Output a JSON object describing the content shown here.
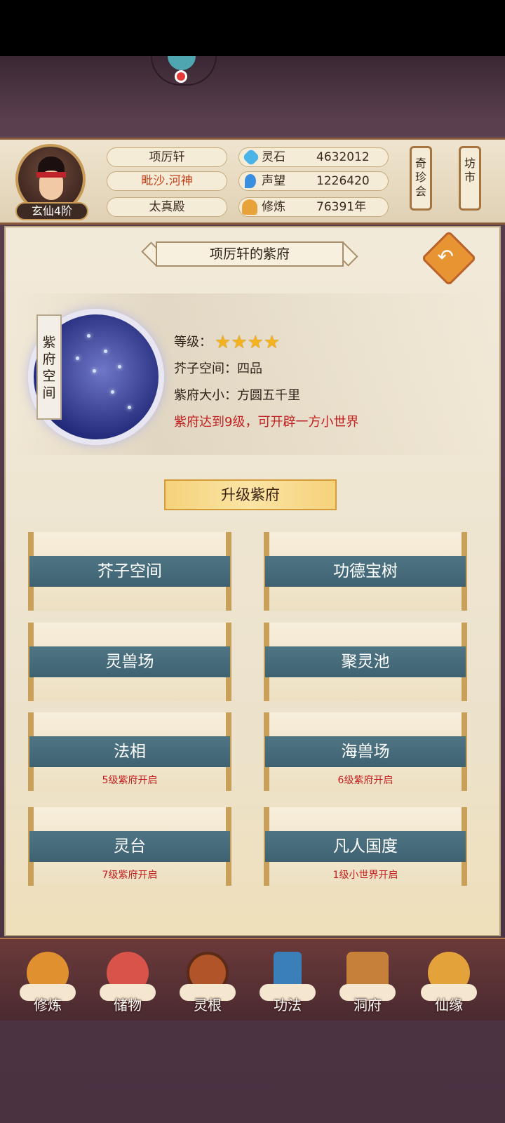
{
  "player": {
    "rank": "玄仙4阶",
    "name": "项厉轩",
    "title": "毗沙.河神",
    "sect": "太真殿"
  },
  "resources": [
    {
      "label": "灵石",
      "value": "4632012",
      "icon": "spirit-stone-icon",
      "color": "#4bb4e6"
    },
    {
      "label": "声望",
      "value": "1226420",
      "icon": "prestige-flame-icon",
      "color": "#3a8ee0"
    },
    {
      "label": "修炼",
      "value": "76391年",
      "icon": "meditation-icon",
      "color": "#e8a23a"
    }
  ],
  "side_buttons": {
    "treasure_fair": "奇珍会",
    "market": "坊市"
  },
  "page": {
    "title": "项厉轩的紫府",
    "back_icon": "return-arrow-icon"
  },
  "info": {
    "orb_label": "紫府空间",
    "level_label": "等级：",
    "stars": 4,
    "space_line": "芥子空间：四品",
    "size_line": "紫府大小：方圆五千里",
    "hint_line": "紫府达到9级，可开辟一方小世界"
  },
  "upgrade_label": "升级紫府",
  "features": [
    {
      "name": "芥子空间",
      "req": ""
    },
    {
      "name": "功德宝树",
      "req": ""
    },
    {
      "name": "灵兽场",
      "req": ""
    },
    {
      "name": "聚灵池",
      "req": ""
    },
    {
      "name": "法相",
      "req": "5级紫府开启"
    },
    {
      "name": "海兽场",
      "req": "6级紫府开启"
    },
    {
      "name": "灵台",
      "req": "7级紫府开启"
    },
    {
      "name": "凡人国度",
      "req": "1级小世界开启"
    }
  ],
  "nav": [
    {
      "label": "修炼",
      "icon": "cultivate-icon",
      "color": "#e0902e"
    },
    {
      "label": "储物",
      "icon": "storage-bag-icon",
      "color": "#d8544a"
    },
    {
      "label": "灵根",
      "icon": "spirit-root-icon",
      "color": "#b0552a"
    },
    {
      "label": "功法",
      "icon": "technique-book-icon",
      "color": "#3b7fb8"
    },
    {
      "label": "洞府",
      "icon": "cave-house-icon",
      "color": "#c7803a"
    },
    {
      "label": "仙缘",
      "icon": "gourd-icon",
      "color": "#e4a23a"
    }
  ]
}
